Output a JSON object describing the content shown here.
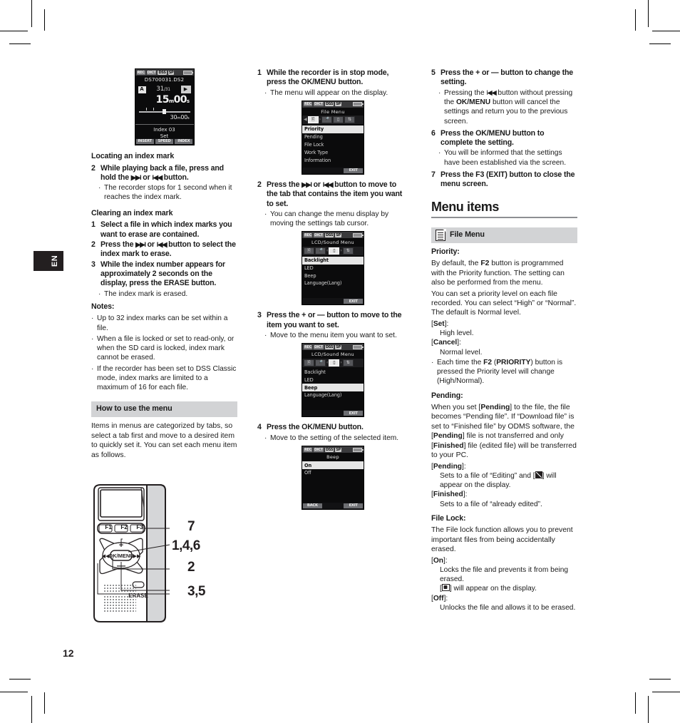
{
  "page": {
    "number": "12",
    "language_tab": "EN"
  },
  "col1": {
    "lcd_playback": {
      "status_chips": [
        "REC",
        "DICT",
        "DSS",
        "SP"
      ],
      "battery": "battery-icon",
      "file_name": "DS700031.DS2",
      "mode_badge": "A",
      "index_current": "31",
      "index_total": "/31",
      "play_icon": "play-icon",
      "elapsed_time": "15",
      "elapsed_min_unit": "m",
      "elapsed_sec": "00",
      "elapsed_sec_unit": "s",
      "total_time": "30",
      "total_sep": "m",
      "total_sec": "00",
      "total_sec_unit": "s",
      "message_line1": "Index 03",
      "message_line2": "Set",
      "softkeys": [
        "INSERT",
        "SPEED",
        "INDEX"
      ]
    },
    "heading_locating": "Locating an index mark",
    "step2_num": "2",
    "step2_text_a": "While playing back a file, press and hold the ",
    "step2_ff": "▶▶l",
    "step2_or": " or ",
    "step2_rew": "l◀◀",
    "step2_text_b": " button.",
    "step2_bullet": "The recorder stops for 1 second when it reaches the index mark.",
    "heading_clearing": "Clearing an index mark",
    "clear_step1_num": "1",
    "clear_step1": "Select a file in which index marks you want to erase are contained.",
    "clear_step2_num": "2",
    "clear_step2_a": "Press the ",
    "clear_step2_b": " button to select the index mark to erase.",
    "clear_step3_num": "3",
    "clear_step3_a": "While the index number appears for approximately 2 seconds on the display, press the ",
    "clear_step3_erase": "ERASE",
    "clear_step3_b": " button.",
    "clear_step3_bullet": "The index mark is erased.",
    "notes_label": "Notes:",
    "notes": [
      "Up to 32 index marks can be set within a file.",
      "When a file is locked or set to read-only, or when the SD card is locked, index mark cannot be erased.",
      "If the recorder has been set to DSS Classic mode, index marks are limited to a maximum of 16 for each file."
    ],
    "howto_bar": "How to use the menu",
    "howto_text": "Items in menus are categorized by tabs, so select a tab first and move to a desired item to quickly set it. You can set each menu item as follows.",
    "recorder": {
      "function_keys": [
        "F1",
        "F2",
        "F3"
      ],
      "ok_menu": "OK/MENU",
      "plus": "+",
      "minus": "—",
      "rew": "l◀◀",
      "ff": "▶▶l",
      "erase": "ERASE",
      "callouts": [
        "7",
        "1,4,6",
        "2",
        "3,5"
      ]
    }
  },
  "col2": {
    "step1_num": "1",
    "step1_a": "While the recorder is in stop mode, press the ",
    "step1_b": "OK/MENU",
    "step1_c": " button.",
    "step1_bullet": "The menu will appear on the display.",
    "lcd_filemenu": {
      "status_chips": [
        "REC",
        "DICT",
        "DSS",
        "SP"
      ],
      "title": "File Menu",
      "tabs": [
        "file-tab",
        "mic-tab",
        "lcd-tab",
        "device-tab"
      ],
      "active_tab_index": 0,
      "items": [
        "Priority",
        "Pending",
        "File Lock",
        "Work Type",
        "Information"
      ],
      "selected_item": "Priority",
      "softkeys": [
        "",
        "",
        "EXIT"
      ]
    },
    "step2_num": "2",
    "step2_a": "Press the ",
    "step2_ff": "▶▶l",
    "step2_or": " or ",
    "step2_rew": "l◀◀",
    "step2_b": " button to move to the tab that contains the item you want to set.",
    "step2_bullet": "You can change the menu display by moving the settings tab cursor.",
    "lcd_lcdsound1": {
      "status_chips": [
        "REC",
        "DICT",
        "DSS",
        "SP"
      ],
      "title": "LCD/Sound Menu",
      "tabs": [
        "file-tab",
        "mic-tab",
        "lcd-tab",
        "device-tab"
      ],
      "active_tab_index": 2,
      "items": [
        "Backlight",
        "LED",
        "Beep",
        "Language(Lang)"
      ],
      "selected_item": "Backlight",
      "softkeys": [
        "",
        "",
        "EXIT"
      ]
    },
    "step3_num": "3",
    "step3_a": "Press the + or — button to move to the item you want to set.",
    "step3_bullet": "Move to the menu item you want to set.",
    "lcd_lcdsound2": {
      "status_chips": [
        "REC",
        "DICT",
        "DSS",
        "SP"
      ],
      "title": "LCD/Sound Menu",
      "tabs": [
        "file-tab",
        "mic-tab",
        "lcd-tab",
        "device-tab"
      ],
      "active_tab_index": 2,
      "items": [
        "Backlight",
        "LED",
        "Beep",
        "Language(Lang)"
      ],
      "selected_item": "Beep",
      "softkeys": [
        "",
        "",
        "EXIT"
      ]
    },
    "step4_num": "4",
    "step4_a": "Press the ",
    "step4_b": "OK/MENU",
    "step4_c": " button.",
    "step4_bullet": "Move to the setting of the selected item.",
    "lcd_beep": {
      "status_chips": [
        "REC",
        "DICT",
        "DSS",
        "SP"
      ],
      "title": "Beep",
      "items": [
        "On",
        "Off"
      ],
      "selected_item": "On",
      "softkeys": [
        "BACK",
        "",
        "EXIT"
      ]
    }
  },
  "col3": {
    "step5_num": "5",
    "step5_a": "Press the + or — button to change the setting.",
    "step5_bullet_a": "Pressing the ",
    "step5_bullet_rew": "l◀◀",
    "step5_bullet_b": " button without pressing the ",
    "step5_bullet_ok": "OK/MENU",
    "step5_bullet_c": " button will cancel the settings and return you to the previous screen.",
    "step6_num": "6",
    "step6_a": "Press the ",
    "step6_b": "OK/MENU",
    "step6_c": " button to complete the setting.",
    "step6_bullet": "You will be informed that the settings have been established via the screen.",
    "step7_num": "7",
    "step7_a": "Press the ",
    "step7_b": "F3 (EXIT)",
    "step7_c": " button to close the menu screen.",
    "menu_items_heading": "Menu items",
    "file_menu_bar": "File Menu",
    "file_menu_icon": "document-icon",
    "priority_label": "Priority:",
    "priority_p1_a": "By default, the ",
    "priority_p1_f2": "F2",
    "priority_p1_b": " button is programmed with the Priority function. The setting can also be performed from the menu.",
    "priority_p2": "You can set a priority level on each file recorded. You can select “High” or “Normal”. The default is Normal level.",
    "priority_set_term": "Set",
    "priority_set_body": "High level.",
    "priority_cancel_term": "Cancel",
    "priority_cancel_body": "Normal level.",
    "priority_bullet_a": "Each time the ",
    "priority_bullet_f2": "F2",
    "priority_bullet_mid": " (",
    "priority_bullet_pri": "PRIORITY",
    "priority_bullet_b": ") button is pressed the Priority level will change (High/Normal).",
    "pending_label": "Pending:",
    "pending_p_a": "When you set [",
    "pending_p_pending": "Pending",
    "pending_p_b": "] to the file, the file becomes “Pending file”. If “Download file” is set to “Finished file” by ODMS software, the [",
    "pending_p_pending2": "Pending",
    "pending_p_c": "] file is not transferred and only [",
    "pending_p_finished": "Finished",
    "pending_p_d": "] file (edited file) will be transferred to your PC.",
    "pending_term": "Pending",
    "pending_body_a": "Sets to a file of “Editing” and [",
    "pending_body_icon": "editing-icon",
    "pending_body_b": "] will appear on the display.",
    "finished_term": "Finished",
    "finished_body": "Sets to a file of “already edited”.",
    "filelock_label": "File Lock:",
    "filelock_p": "The File lock function allows you to prevent important files from being accidentally erased.",
    "filelock_on_term": "On",
    "filelock_on_body1": "Locks the file and prevents it from being erased.",
    "filelock_on_body2_a": "[",
    "filelock_on_icon": "lock-icon",
    "filelock_on_body2_b": "] will appear on the display.",
    "filelock_off_term": "Off",
    "filelock_off_body": "Unlocks the file and allows it to be erased."
  }
}
